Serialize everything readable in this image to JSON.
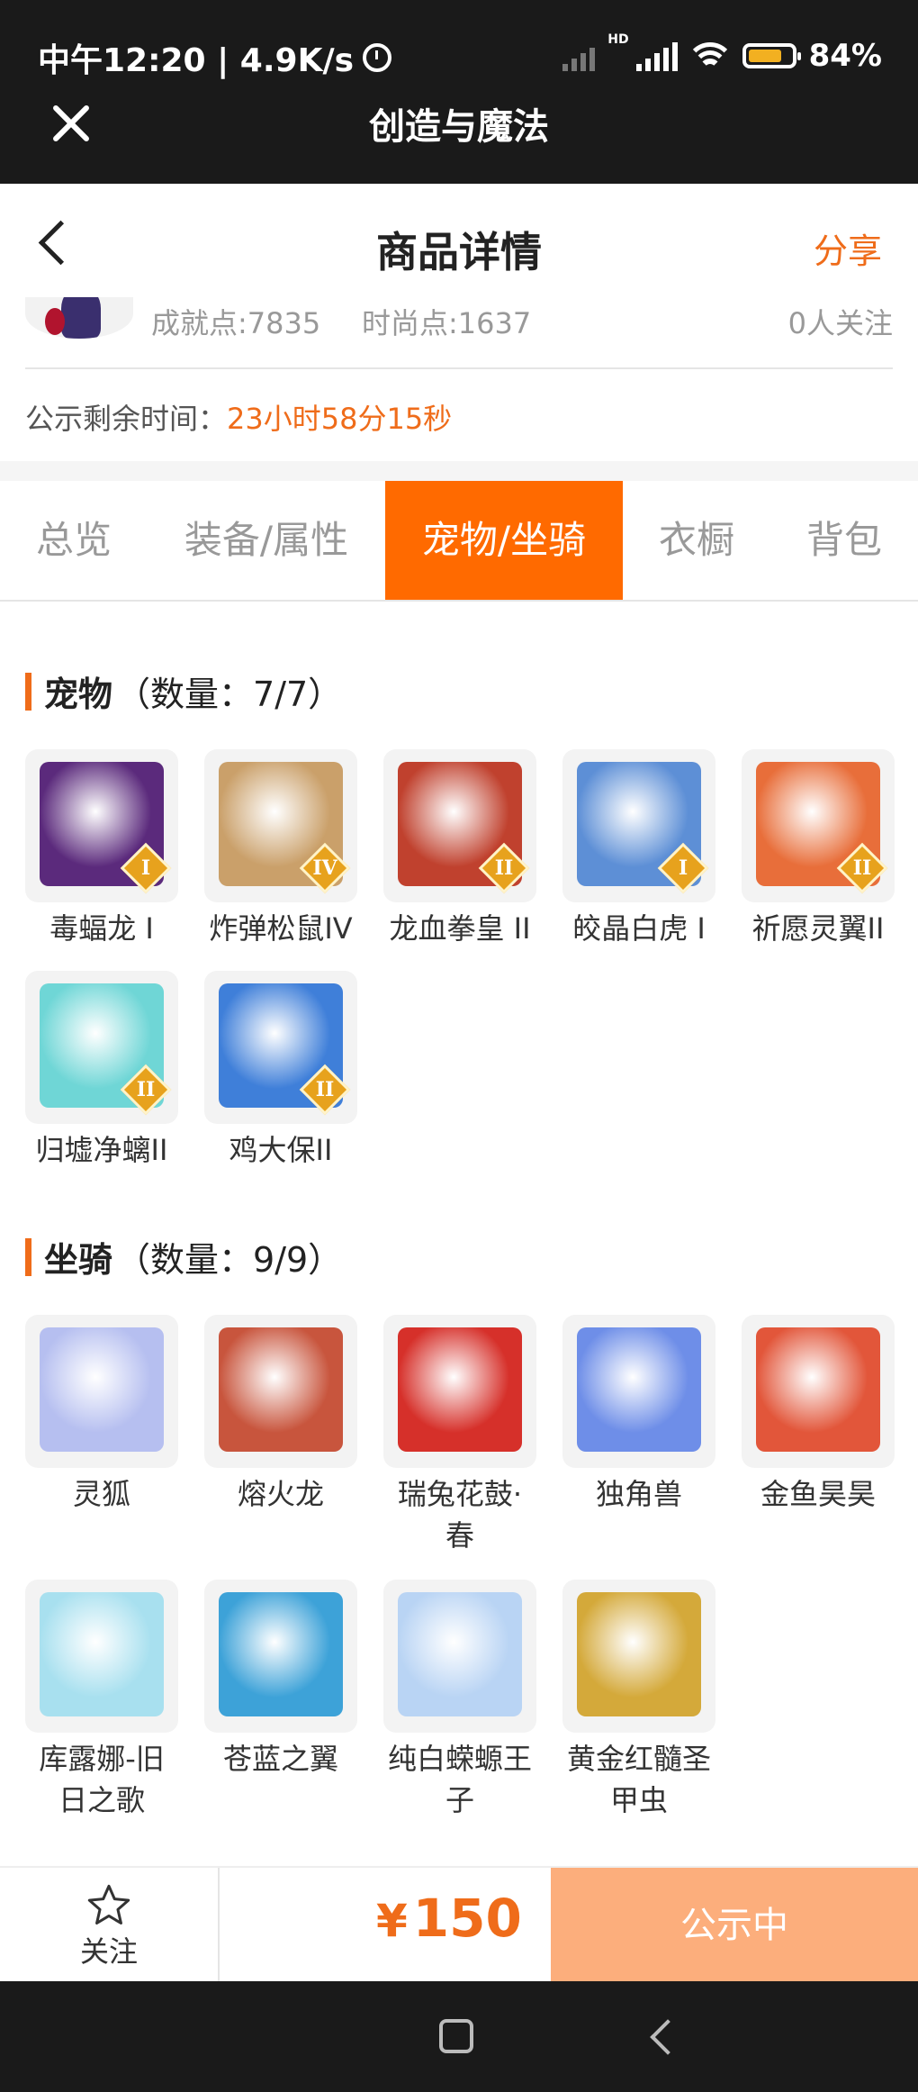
{
  "status_bar": {
    "time": "中午12:20 | 4.9K/s",
    "battery": "84%",
    "hd": "HD"
  },
  "header": {
    "title": "创造与魔法"
  },
  "nav": {
    "title": "商品详情",
    "share": "分享"
  },
  "seller": {
    "achievement": "成就点:7835",
    "fashion": "时尚点:1637",
    "followers": "0人关注"
  },
  "countdown": {
    "label": "公示剩余时间：",
    "value": "23小时58分15秒"
  },
  "tabs": [
    "总览",
    "装备/属性",
    "宠物/坐骑",
    "衣橱",
    "背包"
  ],
  "active_tab": "宠物/坐骑",
  "pets": {
    "title": "宠物",
    "count": "（数量：7/7）",
    "items": [
      {
        "name": "毒蝠龙 I",
        "badge": "I",
        "color": "#5b2a7c"
      },
      {
        "name": "炸弹松鼠IV",
        "badge": "IV",
        "color": "#caa06a"
      },
      {
        "name": "龙血拳皇 II",
        "badge": "II",
        "color": "#c0412e"
      },
      {
        "name": "皎晶白虎 I",
        "badge": "I",
        "color": "#5d8fd6"
      },
      {
        "name": "祈愿灵翼II",
        "badge": "II",
        "color": "#e86e3a"
      },
      {
        "name": "归墟净螭II",
        "badge": "II",
        "color": "#6fd6d6"
      },
      {
        "name": "鸡大保II",
        "badge": "II",
        "color": "#3f7fd9"
      }
    ]
  },
  "mounts": {
    "title": "坐骑",
    "count": "（数量：9/9）",
    "items": [
      {
        "name": "灵狐",
        "color": "#b6bff0"
      },
      {
        "name": "熔火龙",
        "color": "#c8553d"
      },
      {
        "name": "瑞兔花鼓·春",
        "color": "#d6302a"
      },
      {
        "name": "独角兽",
        "color": "#6e8ee8"
      },
      {
        "name": "金鱼昊昊",
        "color": "#e2563a"
      },
      {
        "name": "库露娜-旧日之歌",
        "color": "#a8e0ef"
      },
      {
        "name": "苍蓝之翼",
        "color": "#3da2d8"
      },
      {
        "name": "纯白蝾螈王子",
        "color": "#b9d4f4"
      },
      {
        "name": "黄金红髓圣甲虫",
        "color": "#d4a93a"
      }
    ]
  },
  "bottom": {
    "follow": "关注",
    "currency": "¥",
    "price": "150",
    "status": "公示中"
  },
  "colors": {
    "accent": "#ef6c1a",
    "tab_active": "#ff6a00",
    "status_button": "#fcae7c"
  }
}
